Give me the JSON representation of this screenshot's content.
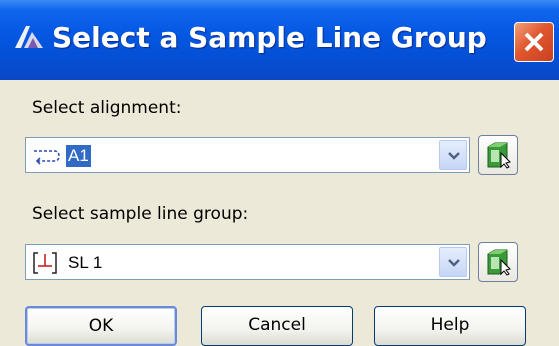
{
  "window": {
    "title": "Select a Sample Line Group"
  },
  "alignment": {
    "label": "Select alignment:",
    "value": "A1",
    "icon": "alignment-icon"
  },
  "sample_line_group": {
    "label": "Select sample line group:",
    "value": "SL 1",
    "icon": "sample-line-group-icon"
  },
  "buttons": {
    "ok": "OK",
    "cancel": "Cancel",
    "help": "Help"
  },
  "colors": {
    "titlebar": "#0558e3",
    "dialog_bg": "#ece9d8",
    "selection": "#316ac5",
    "close_button": "#e0572f"
  }
}
